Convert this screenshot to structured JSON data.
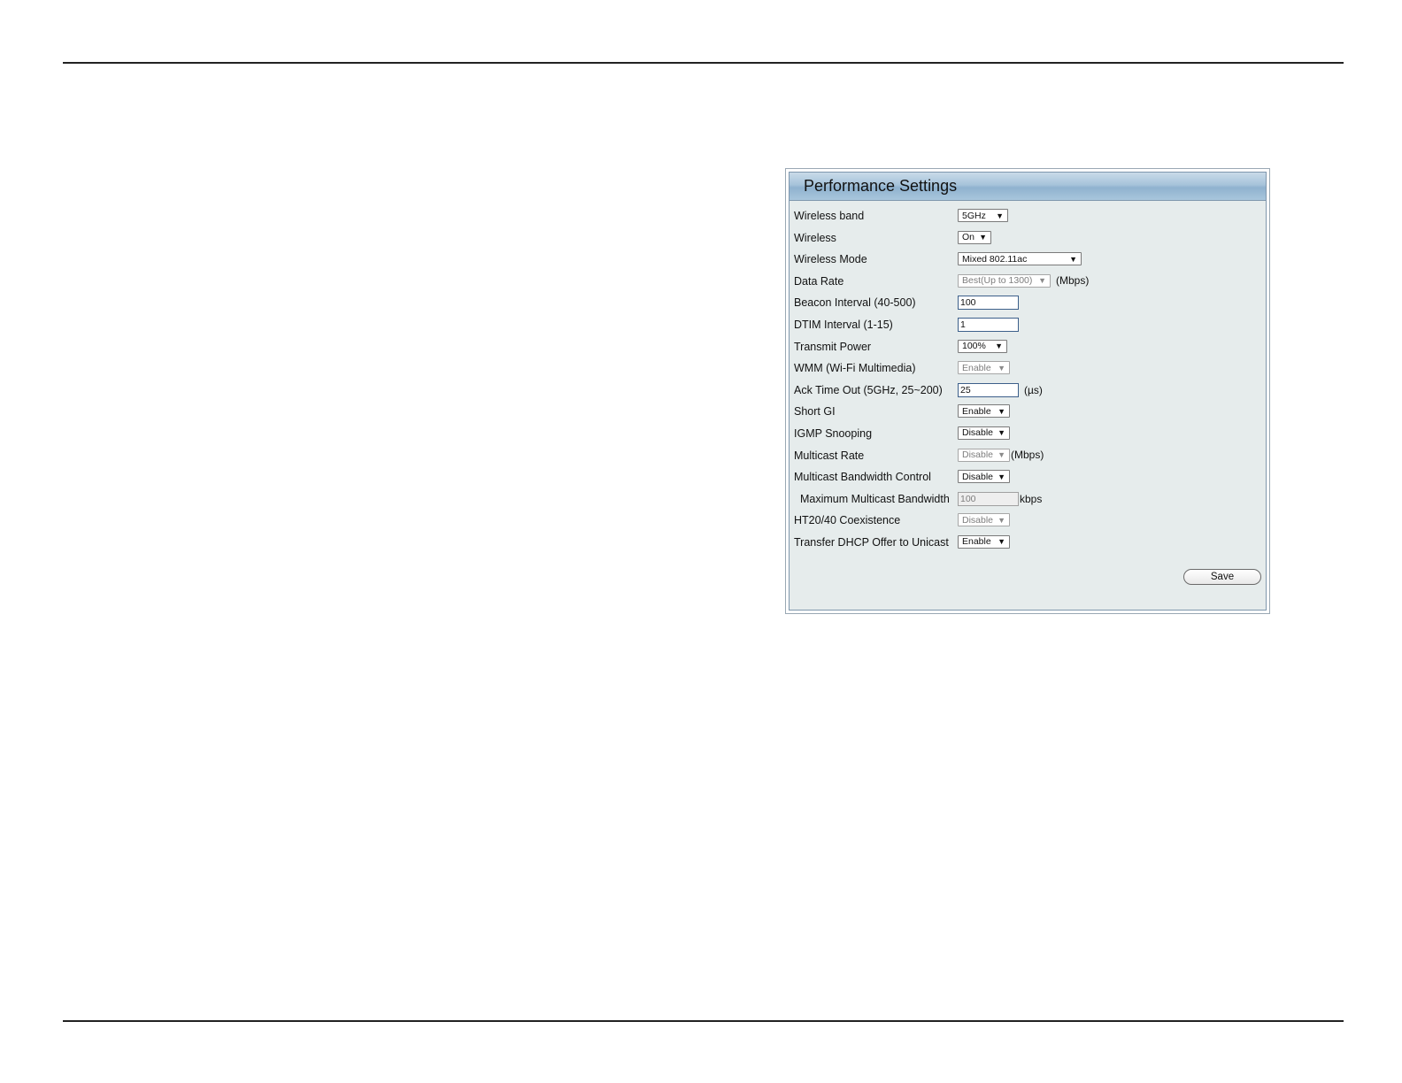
{
  "panel": {
    "title": "Performance Settings",
    "save_label": "Save"
  },
  "fields": {
    "wireless_band": {
      "label": "Wireless band",
      "value": "5GHz"
    },
    "wireless": {
      "label": "Wireless",
      "value": "On"
    },
    "wireless_mode": {
      "label": "Wireless Mode",
      "value": "Mixed 802.11ac"
    },
    "data_rate": {
      "label": "Data Rate",
      "value": "Best(Up to 1300)",
      "unit": "(Mbps)"
    },
    "beacon_interval": {
      "label": "Beacon Interval (40-500)",
      "value": "100"
    },
    "dtim_interval": {
      "label": "DTIM Interval (1-15)",
      "value": "1"
    },
    "transmit_power": {
      "label": "Transmit Power",
      "value": "100%"
    },
    "wmm": {
      "label": "WMM (Wi-Fi Multimedia)",
      "value": "Enable"
    },
    "ack_timeout": {
      "label": "Ack Time Out  (5GHz, 25~200)",
      "value": "25",
      "unit": "(µs)"
    },
    "short_gi": {
      "label": "Short GI",
      "value": "Enable"
    },
    "igmp_snooping": {
      "label": "IGMP Snooping",
      "value": "Disable"
    },
    "multicast_rate": {
      "label": "Multicast Rate",
      "value": "Disable",
      "unit": "(Mbps)"
    },
    "multicast_bw_control": {
      "label": "Multicast Bandwidth Control",
      "value": "Disable"
    },
    "max_multicast_bw": {
      "label": "Maximum Multicast Bandwidth",
      "value": "100",
      "unit": "kbps"
    },
    "ht2040_coexistence": {
      "label": "HT20/40 Coexistence",
      "value": "Disable"
    },
    "dhcp_offer_unicast": {
      "label": "Transfer DHCP Offer to Unicast",
      "value": "Enable"
    }
  },
  "icons": {
    "dropdown": "chevron-down-icon"
  }
}
